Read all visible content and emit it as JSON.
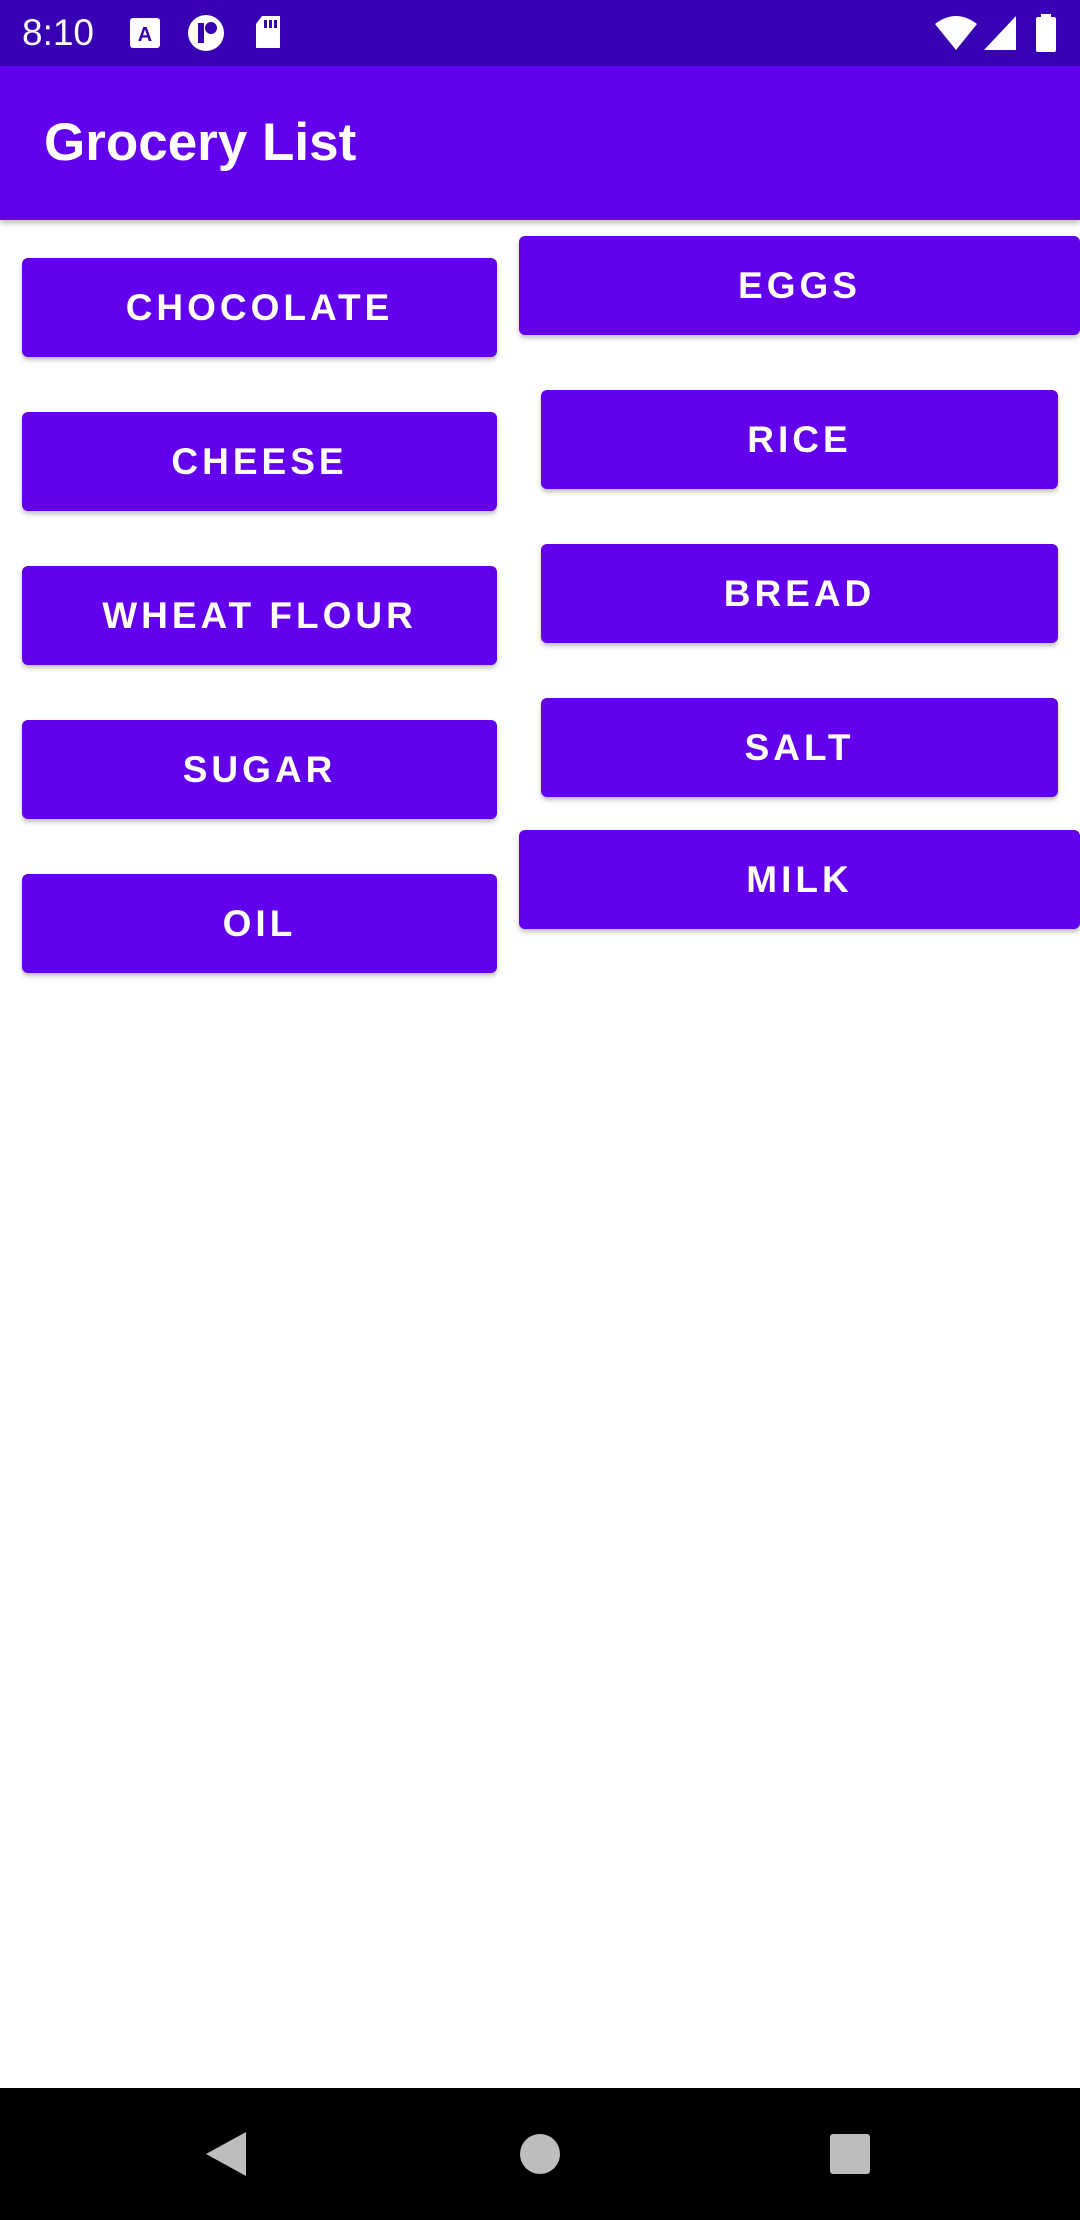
{
  "status_bar": {
    "time": "8:10",
    "left_icons": [
      "accessibility-a-icon",
      "notification-p-icon",
      "sd-card-icon"
    ],
    "right_icons": [
      "wifi-icon",
      "cellular-signal-icon",
      "battery-icon"
    ]
  },
  "app_bar": {
    "title": "Grocery List"
  },
  "colors": {
    "primary": "#6200ee",
    "primary_dark": "#3700b3"
  },
  "grocery_items": {
    "left": [
      "CHOCOLATE",
      "CHEESE",
      "WHEAT FLOUR",
      "SUGAR",
      "OIL"
    ],
    "right": [
      "EGGS",
      "RICE",
      "BREAD",
      "SALT",
      "MILK"
    ]
  },
  "nav_bar": {
    "buttons": [
      "back-icon",
      "home-icon",
      "recents-icon"
    ]
  }
}
